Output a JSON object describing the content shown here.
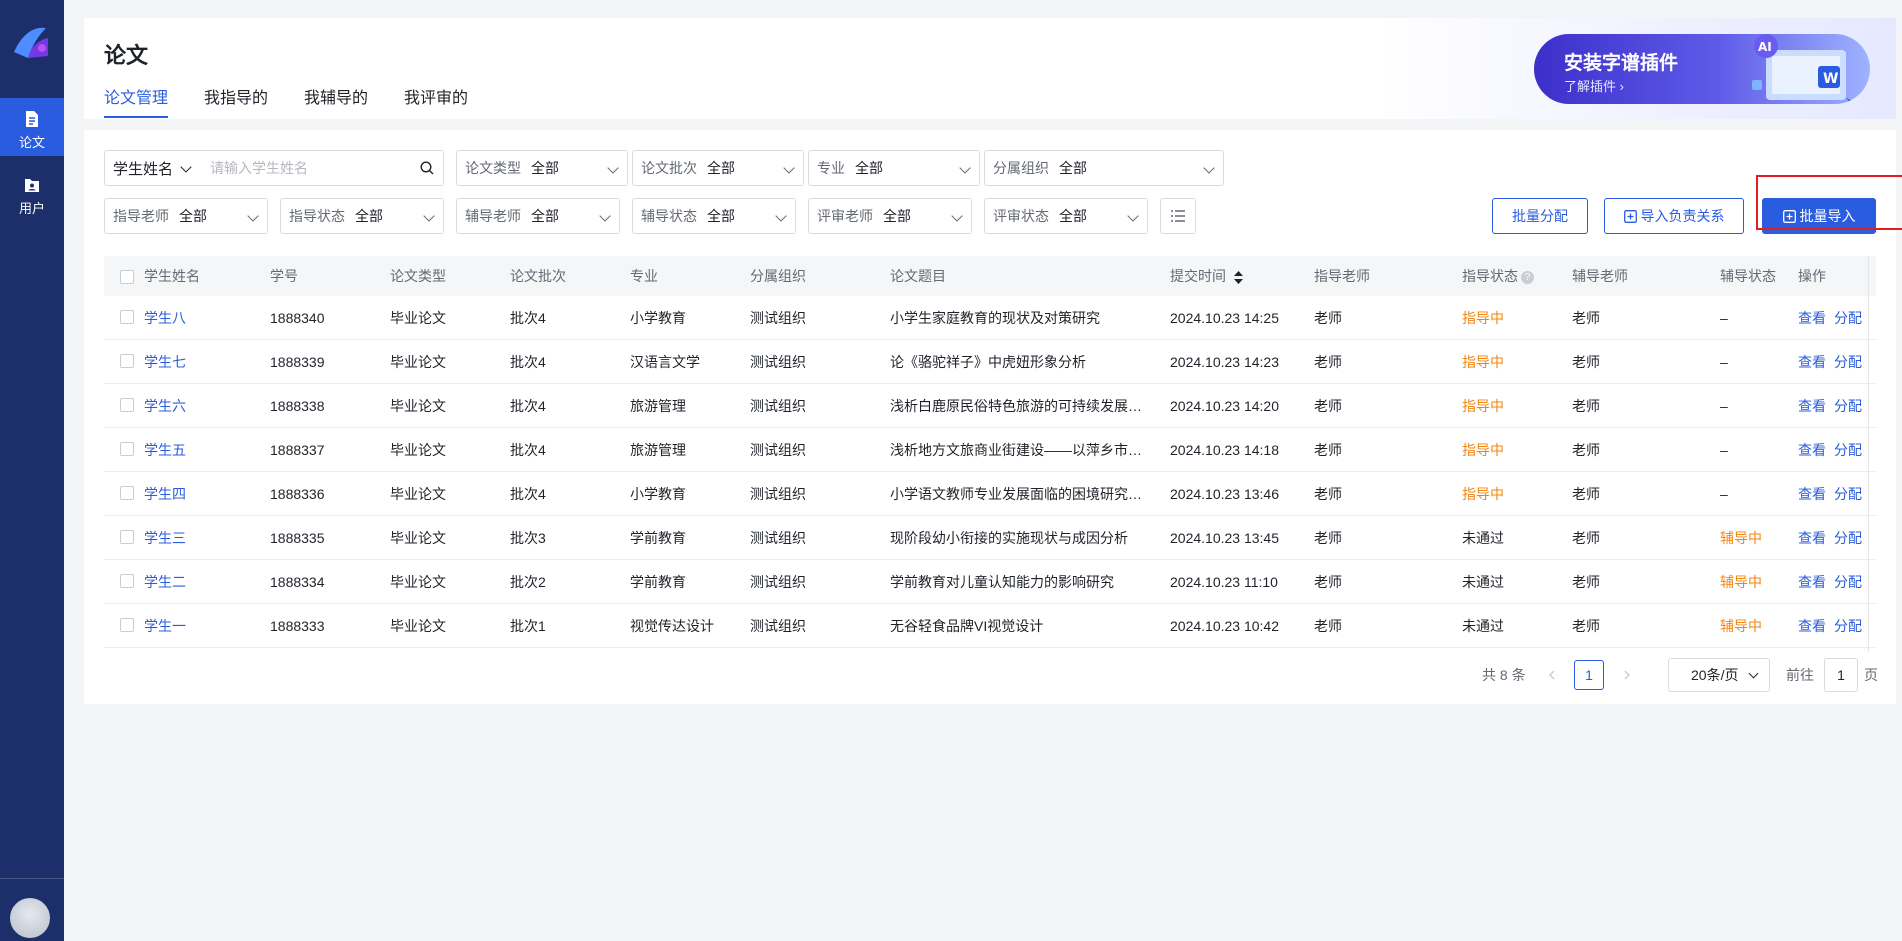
{
  "sidebar": {
    "items": [
      {
        "label": "论文",
        "icon": "document-icon",
        "active": true
      },
      {
        "label": "用户",
        "icon": "user-folder-icon",
        "active": false
      }
    ]
  },
  "header": {
    "title": "论文",
    "tabs": [
      {
        "label": "论文管理",
        "active": true
      },
      {
        "label": "我指导的",
        "active": false
      },
      {
        "label": "我辅导的",
        "active": false
      },
      {
        "label": "我评审的",
        "active": false
      }
    ]
  },
  "promo": {
    "title": "安装字谱插件",
    "subtitle": "了解插件 ›",
    "badge": "AI"
  },
  "search": {
    "field_label": "学生姓名",
    "placeholder": "请输入学生姓名"
  },
  "filters": [
    {
      "label": "论文类型",
      "value": "全部"
    },
    {
      "label": "论文批次",
      "value": "全部"
    },
    {
      "label": "专业",
      "value": "全部"
    },
    {
      "label": "分属组织",
      "value": "全部"
    },
    {
      "label": "指导老师",
      "value": "全部"
    },
    {
      "label": "指导状态",
      "value": "全部"
    },
    {
      "label": "辅导老师",
      "value": "全部"
    },
    {
      "label": "辅导状态",
      "value": "全部"
    },
    {
      "label": "评审老师",
      "value": "全部"
    },
    {
      "label": "评审状态",
      "value": "全部"
    }
  ],
  "actions": {
    "batch_assign": "批量分配",
    "import_relation": "导入负责关系",
    "batch_import": "批量导入"
  },
  "table": {
    "columns": [
      "学生姓名",
      "学号",
      "论文类型",
      "论文批次",
      "专业",
      "分属组织",
      "论文题目",
      "提交时间",
      "指导老师",
      "指导状态",
      "辅导老师",
      "辅导状态",
      "操作"
    ],
    "rows": [
      {
        "name": "学生八",
        "id": "1888340",
        "type": "毕业论文",
        "batch": "批次4",
        "major": "小学教育",
        "org": "测试组织",
        "title": "小学生家庭教育的现状及对策研究",
        "time": "2024.10.23 14:25",
        "advisor": "老师",
        "advisor_status": "指导中",
        "tutor": "老师",
        "tutor_status": "–",
        "view": "查看",
        "assign": "分配"
      },
      {
        "name": "学生七",
        "id": "1888339",
        "type": "毕业论文",
        "batch": "批次4",
        "major": "汉语言文学",
        "org": "测试组织",
        "title": "论《骆驼祥子》中虎妞形象分析",
        "time": "2024.10.23 14:23",
        "advisor": "老师",
        "advisor_status": "指导中",
        "tutor": "老师",
        "tutor_status": "–",
        "view": "查看",
        "assign": "分配"
      },
      {
        "name": "学生六",
        "id": "1888338",
        "type": "毕业论文",
        "batch": "批次4",
        "major": "旅游管理",
        "org": "测试组织",
        "title": "浅析白鹿原民俗特色旅游的可持续发展…",
        "time": "2024.10.23 14:20",
        "advisor": "老师",
        "advisor_status": "指导中",
        "tutor": "老师",
        "tutor_status": "–",
        "view": "查看",
        "assign": "分配"
      },
      {
        "name": "学生五",
        "id": "1888337",
        "type": "毕业论文",
        "batch": "批次4",
        "major": "旅游管理",
        "org": "测试组织",
        "title": "浅析地方文旅商业街建设——以萍乡市…",
        "time": "2024.10.23 14:18",
        "advisor": "老师",
        "advisor_status": "指导中",
        "tutor": "老师",
        "tutor_status": "–",
        "view": "查看",
        "assign": "分配"
      },
      {
        "name": "学生四",
        "id": "1888336",
        "type": "毕业论文",
        "batch": "批次4",
        "major": "小学教育",
        "org": "测试组织",
        "title": "小学语文教师专业发展面临的困境研究…",
        "time": "2024.10.23 13:46",
        "advisor": "老师",
        "advisor_status": "指导中",
        "tutor": "老师",
        "tutor_status": "–",
        "view": "查看",
        "assign": "分配"
      },
      {
        "name": "学生三",
        "id": "1888335",
        "type": "毕业论文",
        "batch": "批次3",
        "major": "学前教育",
        "org": "测试组织",
        "title": "现阶段幼小衔接的实施现状与成因分析",
        "time": "2024.10.23 13:45",
        "advisor": "老师",
        "advisor_status": "未通过",
        "tutor": "老师",
        "tutor_status": "辅导中",
        "view": "查看",
        "assign": "分配"
      },
      {
        "name": "学生二",
        "id": "1888334",
        "type": "毕业论文",
        "batch": "批次2",
        "major": "学前教育",
        "org": "测试组织",
        "title": "学前教育对儿童认知能力的影响研究",
        "time": "2024.10.23 11:10",
        "advisor": "老师",
        "advisor_status": "未通过",
        "tutor": "老师",
        "tutor_status": "辅导中",
        "view": "查看",
        "assign": "分配"
      },
      {
        "name": "学生一",
        "id": "1888333",
        "type": "毕业论文",
        "batch": "批次1",
        "major": "视觉传达设计",
        "org": "测试组织",
        "title": "无谷轻食品牌VI视觉设计",
        "time": "2024.10.23 10:42",
        "advisor": "老师",
        "advisor_status": "未通过",
        "tutor": "老师",
        "tutor_status": "辅导中",
        "view": "查看",
        "assign": "分配"
      }
    ]
  },
  "pagination": {
    "total": "共 8 条",
    "current": "1",
    "page_size": "20条/页",
    "goto_label": "前往",
    "goto_value": "1",
    "page_suffix": "页"
  },
  "colors": {
    "primary": "#2a5ce0",
    "sidebar": "#1d2f6b",
    "warning": "#f5840c",
    "highlight": "#e02020"
  }
}
